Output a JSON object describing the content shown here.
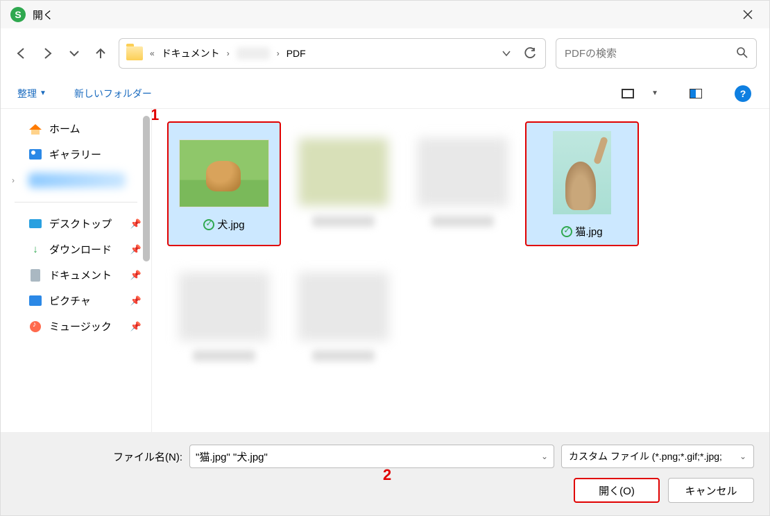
{
  "titlebar": {
    "app_glyph": "S",
    "title": "開く"
  },
  "nav": {
    "crumb_sep1": "«",
    "crumb1": "ドキュメント",
    "crumb_arrow": "›",
    "crumb2": "PDF",
    "search_placeholder": "PDFの検索"
  },
  "toolbar": {
    "organize": "整理",
    "new_folder": "新しいフォルダー",
    "help_glyph": "?"
  },
  "sidebar": {
    "home": "ホーム",
    "gallery": "ギャラリー",
    "desktop": "デスクトップ",
    "downloads": "ダウンロード",
    "documents": "ドキュメント",
    "pictures": "ピクチャ",
    "music": "ミュージック"
  },
  "files": {
    "dog": "犬.jpg",
    "cat": "猫.jpg"
  },
  "annotations": {
    "one": "1",
    "two": "2"
  },
  "footer": {
    "filename_label": "ファイル名(N):",
    "filename_value": "\"猫.jpg\" \"犬.jpg\"",
    "filetype": "カスタム ファイル (*.png;*.gif;*.jpg;",
    "open": "開く(O)",
    "cancel": "キャンセル"
  }
}
